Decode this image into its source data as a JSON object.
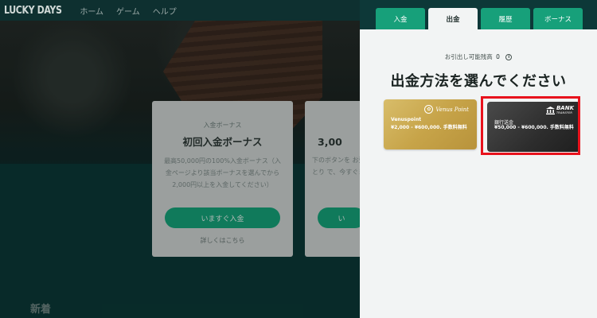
{
  "site": {
    "logo": "LUCKY DAYS",
    "nav": [
      "ホーム",
      "ゲーム",
      "ヘルプ"
    ]
  },
  "promo_cards": [
    {
      "tag": "入金ボーナス",
      "title": "初回入金ボーナス",
      "text": "最高50,000円の100%入金ボーナス（入金ページより該当ボーナスを選んでから2,000円以上を入金してください）",
      "button": "いますぐ入金",
      "link": "詳しくはこちら"
    },
    {
      "title": "3,00",
      "text": "下のボタンを お受けとり で、今すぐま",
      "button": "い"
    }
  ],
  "section_heading": "新着",
  "panel": {
    "tabs": [
      "入金",
      "出金",
      "履歴",
      "ボーナス"
    ],
    "active_tab": "出金",
    "balance_label": "お引出し可能残高",
    "balance_value": "0",
    "heading": "出金方法を選んでください",
    "methods": [
      {
        "logo": "Venus Point",
        "name": "Venuspoint",
        "range": "¥2,000 - ¥600,000. 手数料無料",
        "color": "#c9a74c"
      },
      {
        "logo": "BANK",
        "logo_sub": "TRANSFER",
        "name": "銀行送金",
        "range": "¥50,000 - ¥600,000. 手数料無料",
        "color": "#2e2e2e",
        "highlighted": true
      }
    ]
  },
  "colors": {
    "accent": "#17a07a",
    "panel_bg": "#f2f4f4",
    "page_bg": "#0b3937",
    "highlight": "#e8121c"
  }
}
